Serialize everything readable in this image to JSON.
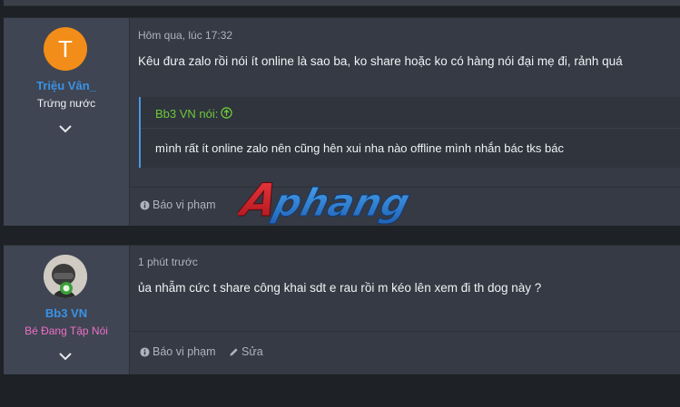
{
  "posts": [
    {
      "author": "Triệu Vân_",
      "user_title": "Trứng nước",
      "avatar_letter": "T",
      "time": "Hôm qua, lúc 17:32",
      "message": "Kêu đưa zalo rồi nói ít online là sao ba, ko share hoặc ko có hàng nói đại mẹ đi, rảnh quá",
      "quote": {
        "author": "Bb3 VN nói:",
        "text": "mình rất ít online zalo nên cũng hên xui nha nào offline mình nhắn bác tks bác"
      },
      "actions": [
        "Báo vi phạm"
      ]
    },
    {
      "author": "Bb3 VN",
      "user_title": "Bé Đang Tập Nói",
      "time": "1 phút trước",
      "message": "ủa nhẫm cức t share công khai sdt e rau rồi m kéo lên xem đi th dog này ?",
      "actions": [
        "Báo vi phạm",
        "Sửa"
      ]
    }
  ],
  "watermark": "Aphang",
  "colors": {
    "username": "#3a93e6",
    "title1": "#f0f2f5",
    "title2": "#ef6fc8",
    "quote_author": "#6ec93a",
    "quote_border": "#4a98e0",
    "avatar_bg": "#f28d19",
    "watermark_red": "#d1222b",
    "watermark_blue": "#2f7fd8"
  },
  "icons": [
    "chevron-down-icon",
    "arrow-up-circle-icon",
    "info-circle-icon",
    "pencil-icon"
  ]
}
